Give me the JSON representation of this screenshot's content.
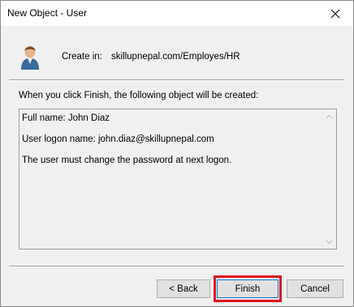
{
  "window": {
    "title": "New Object - User"
  },
  "header": {
    "create_label": "Create in:",
    "create_path": "skillupnepal.com/Employes/HR"
  },
  "description": "When you click Finish, the following object will be created:",
  "summary": {
    "lines": [
      "Full name: John Diaz",
      "User logon name: john.diaz@skillupnepal.com",
      "The user must change the password at next logon."
    ]
  },
  "buttons": {
    "back": "< Back",
    "finish": "Finish",
    "cancel": "Cancel"
  },
  "icons": {
    "close": "close-icon",
    "user": "user-icon",
    "scroll_up": "chevron-up-icon",
    "scroll_down": "chevron-down-icon"
  },
  "colors": {
    "highlight": "#e0141c",
    "focus": "#0078d7"
  }
}
